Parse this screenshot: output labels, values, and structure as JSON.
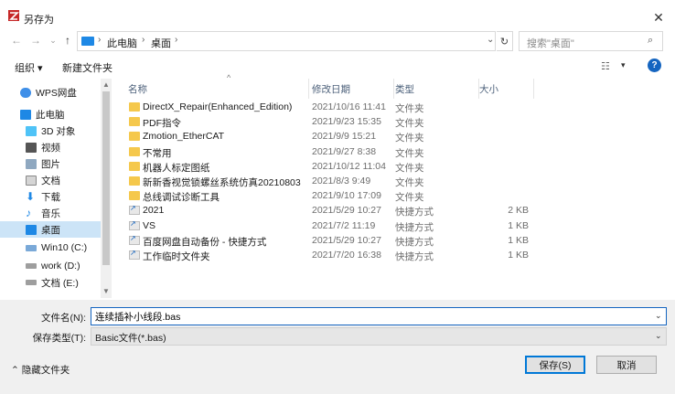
{
  "window": {
    "title": "另存为",
    "close": "✕"
  },
  "address": {
    "path": [
      "此电脑",
      "桌面"
    ],
    "search_placeholder": "搜索\"桌面\""
  },
  "toolbar": {
    "organize": "组织 ▾",
    "new_folder": "新建文件夹"
  },
  "nav": {
    "items": [
      {
        "label": "WPS网盘",
        "icon": "cloud-icon"
      },
      {
        "label": "此电脑",
        "icon": "pc-icon"
      },
      {
        "label": "3D 对象",
        "icon": "3d-objects-icon"
      },
      {
        "label": "视频",
        "icon": "video-icon"
      },
      {
        "label": "图片",
        "icon": "picture-icon"
      },
      {
        "label": "文档",
        "icon": "document-icon"
      },
      {
        "label": "下载",
        "icon": "download-icon"
      },
      {
        "label": "音乐",
        "icon": "music-icon"
      },
      {
        "label": "桌面",
        "icon": "desktop-icon",
        "selected": true
      },
      {
        "label": "Win10 (C:)",
        "icon": "drive-icon"
      },
      {
        "label": "work (D:)",
        "icon": "drive-icon"
      },
      {
        "label": "文档 (E:)",
        "icon": "drive-icon"
      }
    ]
  },
  "columns": {
    "name": "名称",
    "date": "修改日期",
    "type": "类型",
    "size": "大小"
  },
  "files": [
    {
      "name": "DirectX_Repair(Enhanced_Edition)",
      "date": "2021/10/16 11:41",
      "type": "文件夹",
      "size": "",
      "kind": "folder"
    },
    {
      "name": "PDF指令",
      "date": "2021/9/23 15:35",
      "type": "文件夹",
      "size": "",
      "kind": "folder"
    },
    {
      "name": "Zmotion_EtherCAT",
      "date": "2021/9/9 15:21",
      "type": "文件夹",
      "size": "",
      "kind": "folder"
    },
    {
      "name": "不常用",
      "date": "2021/9/27 8:38",
      "type": "文件夹",
      "size": "",
      "kind": "folder"
    },
    {
      "name": "机器人标定图纸",
      "date": "2021/10/12 11:04",
      "type": "文件夹",
      "size": "",
      "kind": "folder"
    },
    {
      "name": "新新香视觉锁螺丝系统仿真20210803",
      "date": "2021/8/3 9:49",
      "type": "文件夹",
      "size": "",
      "kind": "folder"
    },
    {
      "name": "总线调试诊断工具",
      "date": "2021/9/10 17:09",
      "type": "文件夹",
      "size": "",
      "kind": "folder"
    },
    {
      "name": "2021",
      "date": "2021/5/29 10:27",
      "type": "快捷方式",
      "size": "2 KB",
      "kind": "shortcut"
    },
    {
      "name": "VS",
      "date": "2021/7/2 11:19",
      "type": "快捷方式",
      "size": "1 KB",
      "kind": "shortcut"
    },
    {
      "name": "百度网盘自动备份 - 快捷方式",
      "date": "2021/5/29 10:27",
      "type": "快捷方式",
      "size": "1 KB",
      "kind": "shortcut"
    },
    {
      "name": "工作临时文件夹",
      "date": "2021/7/20 16:38",
      "type": "快捷方式",
      "size": "1 KB",
      "kind": "shortcut"
    }
  ],
  "save": {
    "filename_label": "文件名(N):",
    "filename_value": "连续插补小线段.bas",
    "filetype_label": "保存类型(T):",
    "filetype_value": "Basic文件(*.bas)",
    "hide_folders": "隐藏文件夹",
    "save_button": "保存(S)",
    "cancel_button": "取消"
  },
  "colors": {
    "accent": "#0078d7",
    "selected_bg": "#cce4f7",
    "folder": "#f5c84c"
  }
}
